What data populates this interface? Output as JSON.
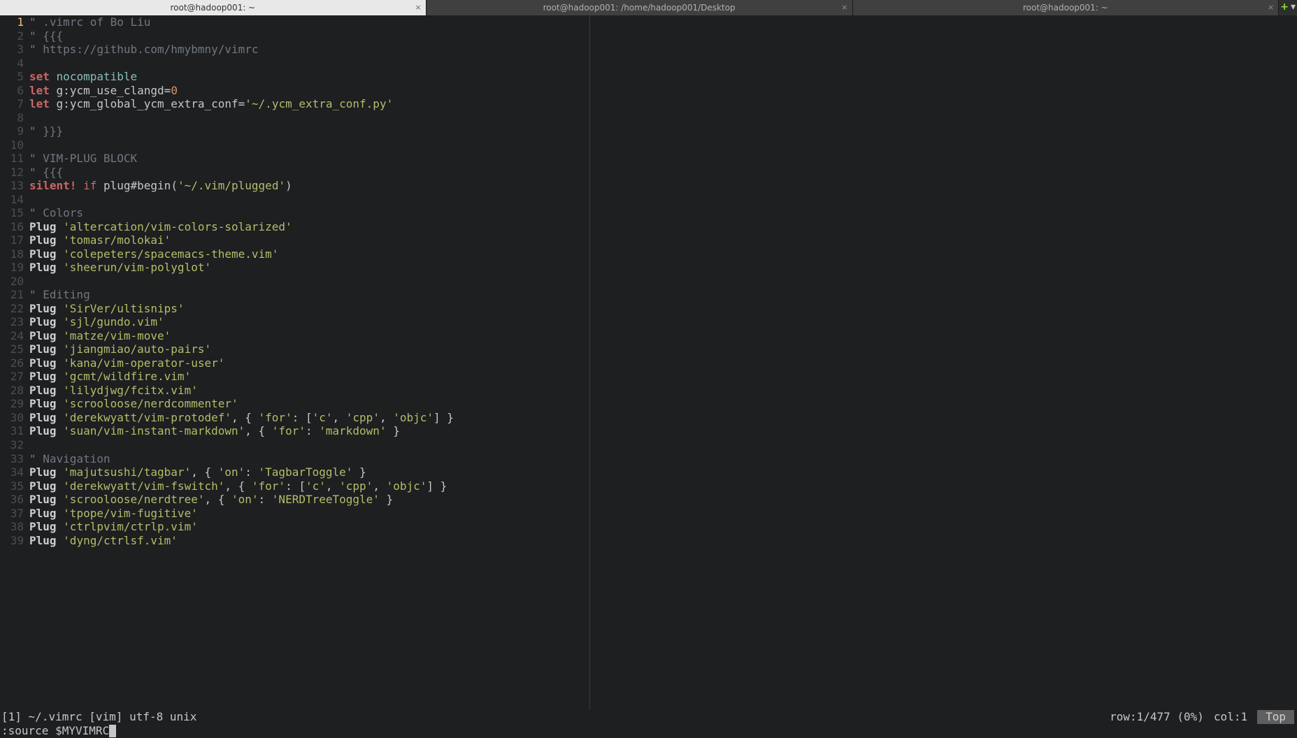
{
  "tabs": [
    {
      "title": "root@hadoop001: ~",
      "active": true
    },
    {
      "title": "root@hadoop001: /home/hadoop001/Desktop",
      "active": false
    },
    {
      "title": "root@hadoop001: ~",
      "active": false
    }
  ],
  "currentLine": 1,
  "lines": [
    {
      "n": 1,
      "tokens": [
        [
          "comment",
          "\" .vimrc of Bo Liu"
        ]
      ]
    },
    {
      "n": 2,
      "tokens": [
        [
          "comment",
          "\" {{{"
        ]
      ]
    },
    {
      "n": 3,
      "tokens": [
        [
          "comment",
          "\" https://github.com/hmybmny/vimrc"
        ]
      ]
    },
    {
      "n": 4,
      "tokens": []
    },
    {
      "n": 5,
      "tokens": [
        [
          "keyword-set",
          "set"
        ],
        [
          "delim",
          " "
        ],
        [
          "option",
          "nocompatible"
        ]
      ]
    },
    {
      "n": 6,
      "tokens": [
        [
          "keyword-let",
          "let"
        ],
        [
          "delim",
          " "
        ],
        [
          "identifier",
          "g:ycm_use_clangd"
        ],
        [
          "delim",
          "="
        ],
        [
          "number",
          "0"
        ]
      ]
    },
    {
      "n": 7,
      "tokens": [
        [
          "keyword-let",
          "let"
        ],
        [
          "delim",
          " "
        ],
        [
          "identifier",
          "g:ycm_global_ycm_extra_conf"
        ],
        [
          "delim",
          "="
        ],
        [
          "string",
          "'~/.ycm_extra_conf.py'"
        ]
      ]
    },
    {
      "n": 8,
      "tokens": []
    },
    {
      "n": 9,
      "tokens": [
        [
          "comment",
          "\" }}}"
        ]
      ]
    },
    {
      "n": 10,
      "tokens": []
    },
    {
      "n": 11,
      "tokens": [
        [
          "comment",
          "\" VIM-PLUG BLOCK"
        ]
      ]
    },
    {
      "n": 12,
      "tokens": [
        [
          "comment",
          "\" {{{"
        ]
      ]
    },
    {
      "n": 13,
      "tokens": [
        [
          "keyword-silent",
          "silent"
        ],
        [
          "keyword-silent",
          "!"
        ],
        [
          "delim",
          " "
        ],
        [
          "keyword-if",
          "if"
        ],
        [
          "delim",
          " "
        ],
        [
          "identifier",
          "plug#begin"
        ],
        [
          "delim",
          "("
        ],
        [
          "string",
          "'~/.vim/plugged'"
        ],
        [
          "delim",
          ")"
        ]
      ]
    },
    {
      "n": 14,
      "tokens": []
    },
    {
      "n": 15,
      "tokens": [
        [
          "comment",
          "\" Colors"
        ]
      ]
    },
    {
      "n": 16,
      "tokens": [
        [
          "plug",
          "Plug"
        ],
        [
          "delim",
          " "
        ],
        [
          "string",
          "'altercation/vim-colors-solarized'"
        ]
      ]
    },
    {
      "n": 17,
      "tokens": [
        [
          "plug",
          "Plug"
        ],
        [
          "delim",
          " "
        ],
        [
          "string",
          "'tomasr/molokai'"
        ]
      ]
    },
    {
      "n": 18,
      "tokens": [
        [
          "plug",
          "Plug"
        ],
        [
          "delim",
          " "
        ],
        [
          "string",
          "'colepeters/spacemacs-theme.vim'"
        ]
      ]
    },
    {
      "n": 19,
      "tokens": [
        [
          "plug",
          "Plug"
        ],
        [
          "delim",
          " "
        ],
        [
          "string",
          "'sheerun/vim-polyglot'"
        ]
      ]
    },
    {
      "n": 20,
      "tokens": []
    },
    {
      "n": 21,
      "tokens": [
        [
          "comment",
          "\" Editing"
        ]
      ]
    },
    {
      "n": 22,
      "tokens": [
        [
          "plug",
          "Plug"
        ],
        [
          "delim",
          " "
        ],
        [
          "string",
          "'SirVer/ultisnips'"
        ]
      ]
    },
    {
      "n": 23,
      "tokens": [
        [
          "plug",
          "Plug"
        ],
        [
          "delim",
          " "
        ],
        [
          "string",
          "'sjl/gundo.vim'"
        ]
      ]
    },
    {
      "n": 24,
      "tokens": [
        [
          "plug",
          "Plug"
        ],
        [
          "delim",
          " "
        ],
        [
          "string",
          "'matze/vim-move'"
        ]
      ]
    },
    {
      "n": 25,
      "tokens": [
        [
          "plug",
          "Plug"
        ],
        [
          "delim",
          " "
        ],
        [
          "string",
          "'jiangmiao/auto-pairs'"
        ]
      ]
    },
    {
      "n": 26,
      "tokens": [
        [
          "plug",
          "Plug"
        ],
        [
          "delim",
          " "
        ],
        [
          "string",
          "'kana/vim-operator-user'"
        ]
      ]
    },
    {
      "n": 27,
      "tokens": [
        [
          "plug",
          "Plug"
        ],
        [
          "delim",
          " "
        ],
        [
          "string",
          "'gcmt/wildfire.vim'"
        ]
      ]
    },
    {
      "n": 28,
      "tokens": [
        [
          "plug",
          "Plug"
        ],
        [
          "delim",
          " "
        ],
        [
          "string",
          "'lilydjwg/fcitx.vim'"
        ]
      ]
    },
    {
      "n": 29,
      "tokens": [
        [
          "plug",
          "Plug"
        ],
        [
          "delim",
          " "
        ],
        [
          "string",
          "'scrooloose/nerdcommenter'"
        ]
      ]
    },
    {
      "n": 30,
      "tokens": [
        [
          "plug",
          "Plug"
        ],
        [
          "delim",
          " "
        ],
        [
          "string",
          "'derekwyatt/vim-protodef'"
        ],
        [
          "delim",
          ", "
        ],
        [
          "dict",
          "{ "
        ],
        [
          "string",
          "'for'"
        ],
        [
          "dict",
          ": ["
        ],
        [
          "string",
          "'c'"
        ],
        [
          "dict",
          ", "
        ],
        [
          "string",
          "'cpp'"
        ],
        [
          "dict",
          ", "
        ],
        [
          "string",
          "'objc'"
        ],
        [
          "dict",
          "] }"
        ]
      ]
    },
    {
      "n": 31,
      "tokens": [
        [
          "plug",
          "Plug"
        ],
        [
          "delim",
          " "
        ],
        [
          "string",
          "'suan/vim-instant-markdown'"
        ],
        [
          "delim",
          ", "
        ],
        [
          "dict",
          "{ "
        ],
        [
          "string",
          "'for'"
        ],
        [
          "dict",
          ": "
        ],
        [
          "string",
          "'markdown'"
        ],
        [
          "dict",
          " }"
        ]
      ]
    },
    {
      "n": 32,
      "tokens": []
    },
    {
      "n": 33,
      "tokens": [
        [
          "comment",
          "\" Navigation"
        ]
      ]
    },
    {
      "n": 34,
      "tokens": [
        [
          "plug",
          "Plug"
        ],
        [
          "delim",
          " "
        ],
        [
          "string",
          "'majutsushi/tagbar'"
        ],
        [
          "delim",
          ", "
        ],
        [
          "dict",
          "{ "
        ],
        [
          "string",
          "'on'"
        ],
        [
          "dict",
          ": "
        ],
        [
          "string",
          "'TagbarToggle'"
        ],
        [
          "dict",
          " }"
        ]
      ]
    },
    {
      "n": 35,
      "tokens": [
        [
          "plug",
          "Plug"
        ],
        [
          "delim",
          " "
        ],
        [
          "string",
          "'derekwyatt/vim-fswitch'"
        ],
        [
          "delim",
          ", "
        ],
        [
          "dict",
          "{ "
        ],
        [
          "string",
          "'for'"
        ],
        [
          "dict",
          ": ["
        ],
        [
          "string",
          "'c'"
        ],
        [
          "dict",
          ", "
        ],
        [
          "string",
          "'cpp'"
        ],
        [
          "dict",
          ", "
        ],
        [
          "string",
          "'objc'"
        ],
        [
          "dict",
          "] }"
        ]
      ]
    },
    {
      "n": 36,
      "tokens": [
        [
          "plug",
          "Plug"
        ],
        [
          "delim",
          " "
        ],
        [
          "string",
          "'scrooloose/nerdtree'"
        ],
        [
          "delim",
          ", "
        ],
        [
          "dict",
          "{ "
        ],
        [
          "string",
          "'on'"
        ],
        [
          "dict",
          ": "
        ],
        [
          "string",
          "'NERDTreeToggle'"
        ],
        [
          "dict",
          " }"
        ]
      ]
    },
    {
      "n": 37,
      "tokens": [
        [
          "plug",
          "Plug"
        ],
        [
          "delim",
          " "
        ],
        [
          "string",
          "'tpope/vim-fugitive'"
        ]
      ]
    },
    {
      "n": 38,
      "tokens": [
        [
          "plug",
          "Plug"
        ],
        [
          "delim",
          " "
        ],
        [
          "string",
          "'ctrlpvim/ctrlp.vim'"
        ]
      ]
    },
    {
      "n": 39,
      "tokens": [
        [
          "plug",
          "Plug"
        ],
        [
          "delim",
          " "
        ],
        [
          "string",
          "'dyng/ctrlsf.vim'"
        ]
      ]
    }
  ],
  "status": {
    "bufinfo": "[1]",
    "file": "~/.vimrc",
    "filetype": "[vim]",
    "encoding": "utf-8",
    "fileformat": "unix",
    "rowcol": "row:1/477 (0%)",
    "col": "col:1",
    "position": "Top"
  },
  "cmdline": ":source $MYVIMRC"
}
